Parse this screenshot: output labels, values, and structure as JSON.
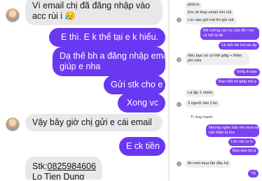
{
  "chat": {
    "messages": [
      {
        "lines": [
          "Vì email chị đã đăng nhập vào",
          "acc rùi i 😥"
        ]
      },
      {
        "text": "E thì. E k thể tại e k hiểu."
      },
      {
        "lines": [
          "Dạ thế bh a đăng nhập email",
          "giúp e nha"
        ]
      },
      {
        "text": "Gửi stk cho e"
      },
      {
        "text": "Xong vc"
      },
      {
        "text": "Vậy bây giờ chị gửi e cái email"
      },
      {
        "text": "E ck tiền"
      },
      {
        "stk_label": "Stk:",
        "stk_number": "0825984606",
        "name": "Lo Tien Dung"
      }
    ]
  },
  "side_chat": {
    "messages": [
      {
        "text": "phải lo"
      },
      {
        "text": "Em sẽ thay email cho chị"
      },
      {
        "text": "Lúc nào gửi mã thì gửi mã"
      },
      {
        "lines": [
          "Mk tưởng coc trc vào đk / mx",
          "ck hết là đk"
        ]
      },
      {
        "text": "Ck hết mk hơi sợ ấy"
      },
      {
        "lines": [
          "Nếu bạn sợ có thể gdtg + thêm",
          "phí nữa"
        ]
      },
      {
        "text": "Gdtg ik bạn"
      },
      {
        "text": "Bạn viết rồi giúp mk ạ"
      },
      {
        "text": "Là lập 1 nhóm"
      },
      {
        "text": "3 người vào ý bn"
      },
      {
        "text": "Tr ăng mạnh"
      },
      {
        "lines": [
          "Nhưng nghe bảo mn mua này k",
          "cần thận  bị lừa"
        ]
      },
      {
        "text": "Lên mk cx lo"
      },
      {
        "text": "Bạn bán bn ạ"
      },
      {
        "text": "Bn mới mua lần đầu hả"
      },
      {
        "text": "Vg"
      }
    ]
  },
  "colors": {
    "outgoing": "#6a37f2",
    "incoming": "#e8e8ea"
  }
}
